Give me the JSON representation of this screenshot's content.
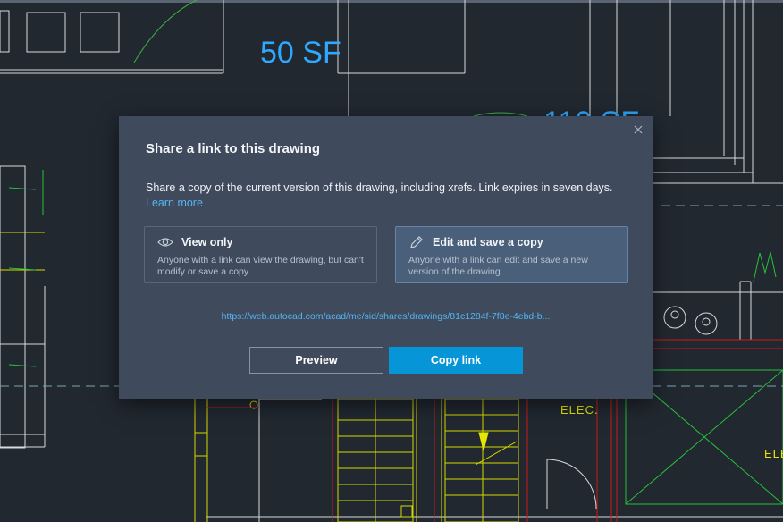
{
  "background": {
    "labels": {
      "area_a": "50 SF",
      "area_b": "110 SF",
      "elec_a": "ELEC.",
      "elec_b": "ELE"
    }
  },
  "dialog": {
    "title": "Share a link to this drawing",
    "description": "Share a copy of the current version of this drawing, including xrefs. Link expires in seven days.",
    "learn_more": "Learn more",
    "options": {
      "view_only": {
        "title": "View only",
        "description": "Anyone with a link can view the drawing, but can't modify or save a copy",
        "icon": "eye-icon"
      },
      "edit_copy": {
        "title": "Edit and save a copy",
        "description": "Anyone with a link can edit and save a new version of the drawing",
        "icon": "pencil-icon",
        "selected": true
      }
    },
    "link": "https://web.autocad.com/acad/me/sid/shares/drawings/81c1284f-7f8e-4ebd-b...",
    "buttons": {
      "preview": "Preview",
      "copy_link": "Copy link"
    }
  },
  "colors": {
    "canvas_bg": "#212830",
    "dialog_bg": "#3f4a5c",
    "accent": "#0696d7",
    "link": "#56b4f0",
    "selected_option": "#4a5f79"
  }
}
